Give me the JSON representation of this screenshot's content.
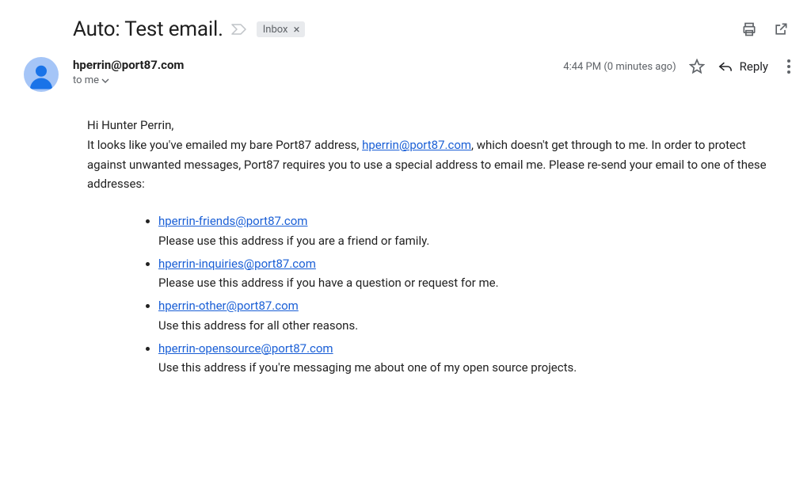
{
  "subject": "Auto: Test email.",
  "inbox_chip": {
    "label": "Inbox"
  },
  "sender": {
    "address": "hperrin@port87.com",
    "recipient_line": "to me"
  },
  "meta": {
    "timestamp": "4:44 PM (0 minutes ago)",
    "reply_label": "Reply"
  },
  "body": {
    "greeting": "Hi Hunter Perrin,",
    "para_pre": "It looks like you've emailed my bare Port87 address, ",
    "bare_address": "hperrin@port87.com",
    "para_post": ", which doesn't get through to me. In order to protect against unwanted messages, Port87 requires you to use a special address to email me. Please re-send your email to one of these addresses:",
    "addresses": [
      {
        "email": "hperrin-friends@port87.com",
        "desc": "Please use this address if you are a friend or family."
      },
      {
        "email": "hperrin-inquiries@port87.com",
        "desc": "Please use this address if you have a question or request for me."
      },
      {
        "email": "hperrin-other@port87.com",
        "desc": "Use this address for all other reasons."
      },
      {
        "email": "hperrin-opensource@port87.com",
        "desc": "Use this address if you're messaging me about one of my open source projects."
      }
    ]
  }
}
